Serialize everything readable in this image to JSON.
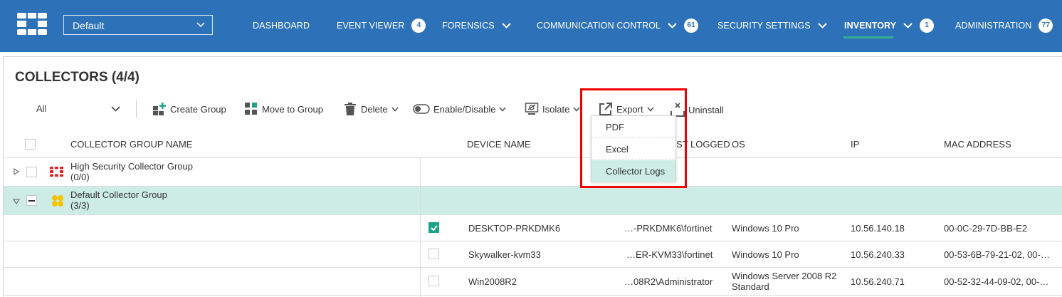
{
  "nav": {
    "org": "Default",
    "items": [
      {
        "label": "DASHBOARD"
      },
      {
        "label": "EVENT VIEWER",
        "badge": "4"
      },
      {
        "label": "FORENSICS"
      },
      {
        "label": "COMMUNICATION CONTROL",
        "badge": "61"
      },
      {
        "label": "SECURITY SETTINGS"
      },
      {
        "label": "INVENTORY",
        "badge": "1"
      },
      {
        "label": "ADMINISTRATION",
        "badge": "77"
      }
    ]
  },
  "page": {
    "title": "COLLECTORS (4/4)"
  },
  "toolbar": {
    "filter": "All",
    "create_group": "Create Group",
    "move_to_group": "Move to Group",
    "delete": "Delete",
    "enable_disable": "Enable/Disable",
    "isolate": "Isolate",
    "export": "Export",
    "uninstall": "Uninstall"
  },
  "export_menu": {
    "items": [
      "PDF",
      "Excel",
      "Collector Logs"
    ],
    "highlighted": "Collector Logs"
  },
  "table": {
    "columns": {
      "group": "COLLECTOR GROUP NAME",
      "device": "DEVICE NAME",
      "last_logged": "ST LOGGED",
      "os": "OS",
      "ip": "IP",
      "mac": "MAC ADDRESS"
    },
    "groups": [
      {
        "name": "High Security Collector Group",
        "count": "(0/0)",
        "expanded": false
      },
      {
        "name": "Default Collector Group",
        "count": "(3/3)",
        "expanded": true
      }
    ],
    "rows": [
      {
        "device": "DESKTOP-PRKDMK6",
        "user": "…-PRKDMK6\\fortinet",
        "os": "Windows 10 Pro",
        "ip": "10.56.140.18",
        "mac": "00-0C-29-7D-BB-E2",
        "checked": true
      },
      {
        "device": "Skywalker-kvm33",
        "user": "…ER-KVM33\\fortinet",
        "os": "Windows 10 Pro",
        "ip": "10.56.240.33",
        "mac": "00-53-6B-79-21-02, 00-…",
        "checked": false
      },
      {
        "device": "Win2008R2",
        "user": "…08R2\\Administrator",
        "os": "Windows Server 2008 R2 Standard",
        "ip": "10.56.240.71",
        "mac": "00-52-32-44-09-02, 00-…",
        "checked": false
      }
    ]
  },
  "colors": {
    "nav_bg": "#2d72b8",
    "accent": "#1aa389",
    "selection": "#cdece5",
    "highlight_box": "#f00000"
  }
}
